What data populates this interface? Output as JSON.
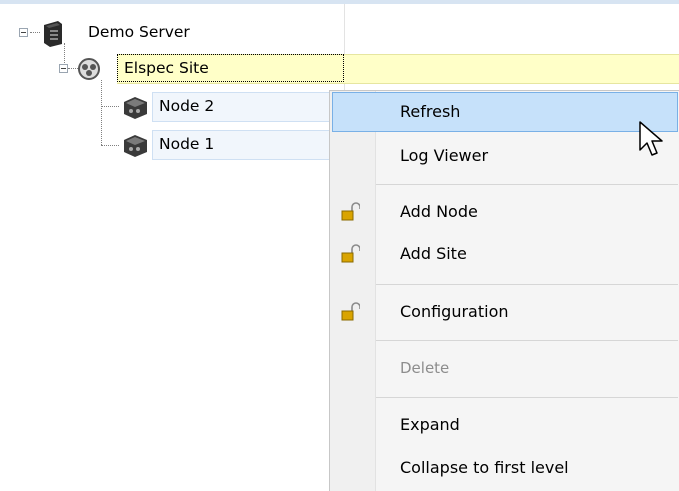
{
  "tree": {
    "server": {
      "label": "Demo Server",
      "icon": "server-icon"
    },
    "site": {
      "label": "Elspec Site",
      "icon": "site-icon"
    },
    "nodes": [
      {
        "label": "Node 2",
        "icon": "node-icon"
      },
      {
        "label": "Node 1",
        "icon": "node-icon"
      }
    ]
  },
  "context_menu": {
    "items": [
      {
        "label": "Refresh",
        "state": "highlighted"
      },
      {
        "label": "Log Viewer"
      },
      {
        "label": "Add Node",
        "icon": "lock-icon"
      },
      {
        "label": "Add Site",
        "icon": "lock-icon"
      },
      {
        "label": "Configuration",
        "icon": "lock-icon"
      },
      {
        "label": "Delete",
        "state": "disabled"
      },
      {
        "label": "Expand"
      },
      {
        "label": "Collapse to first level"
      }
    ]
  },
  "colors": {
    "selected_row_bg": "#ffffc8",
    "menu_highlight_bg": "#c6e1fa",
    "menu_highlight_border": "#79b0e6",
    "node_row_bg": "#f1f6fc"
  }
}
